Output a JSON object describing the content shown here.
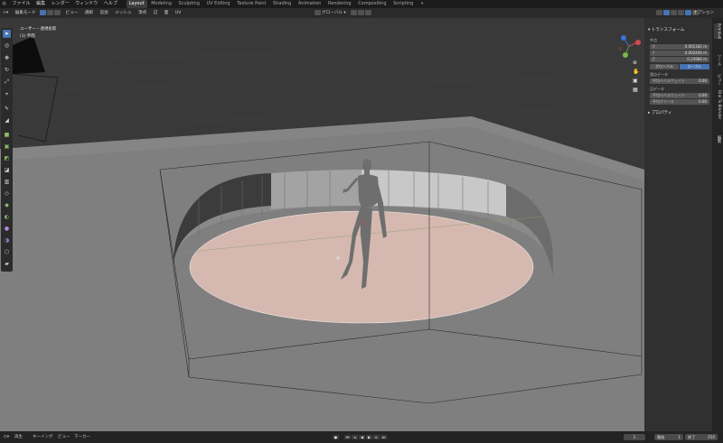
{
  "top_menu": {
    "items": [
      "ファイル",
      "編集",
      "レンダー",
      "ウィンドウ",
      "ヘルプ"
    ],
    "workspaces": [
      "Layout",
      "Modeling",
      "Sculpting",
      "UV Editing",
      "Texture Paint",
      "Shading",
      "Animation",
      "Rendering",
      "Compositing",
      "Scripting"
    ],
    "active_workspace": "Layout",
    "add_tab": "+"
  },
  "header": {
    "mode": "編集モード",
    "menus": [
      "ビュー",
      "選択",
      "追加",
      "メッシュ",
      "頂点",
      "辺",
      "面",
      "UV"
    ],
    "transform_orientation": "グローバル",
    "options_label": "オプション"
  },
  "viewport": {
    "view_name": "ユーザー・透視投影",
    "object_name": "(1) 平面"
  },
  "sidebar": {
    "transform_title": "トランスフォーム",
    "median_label": "中点",
    "fields": [
      {
        "axis": "X",
        "value": "0.001182 m"
      },
      {
        "axis": "Y",
        "value": "0.002404 m"
      },
      {
        "axis": "Z",
        "value": "0.24966 m"
      }
    ],
    "global_btn": "グローバル",
    "local_btn": "ローカル",
    "vertex_data_title": "頂点データ",
    "vertex_bevel_label": "平均ベベルウェイト",
    "vertex_bevel_value": "0.00",
    "edge_data_title": "辺データ",
    "edge_bevel_label": "平均ベベルウェイト",
    "edge_bevel_value": "0.00",
    "edge_crease_label": "平均クリース",
    "edge_crease_value": "0.00",
    "properties_title": "プロパティ"
  },
  "vertical_tabs": [
    "アイテム",
    "ツール",
    "ビュー",
    "Dial To Blender",
    "編集"
  ],
  "timeline": {
    "menus": [
      "再生",
      "キーイング",
      "ビュー",
      "マーカー"
    ],
    "current_frame": "1",
    "start_label": "開始",
    "start_value": "1",
    "end_label": "終了",
    "end_value": "250"
  },
  "colors": {
    "active_blue": "#4772b3",
    "viewport_bg": "#393939",
    "floor": "#7f7f7f",
    "disk": "#d5b9b0"
  }
}
